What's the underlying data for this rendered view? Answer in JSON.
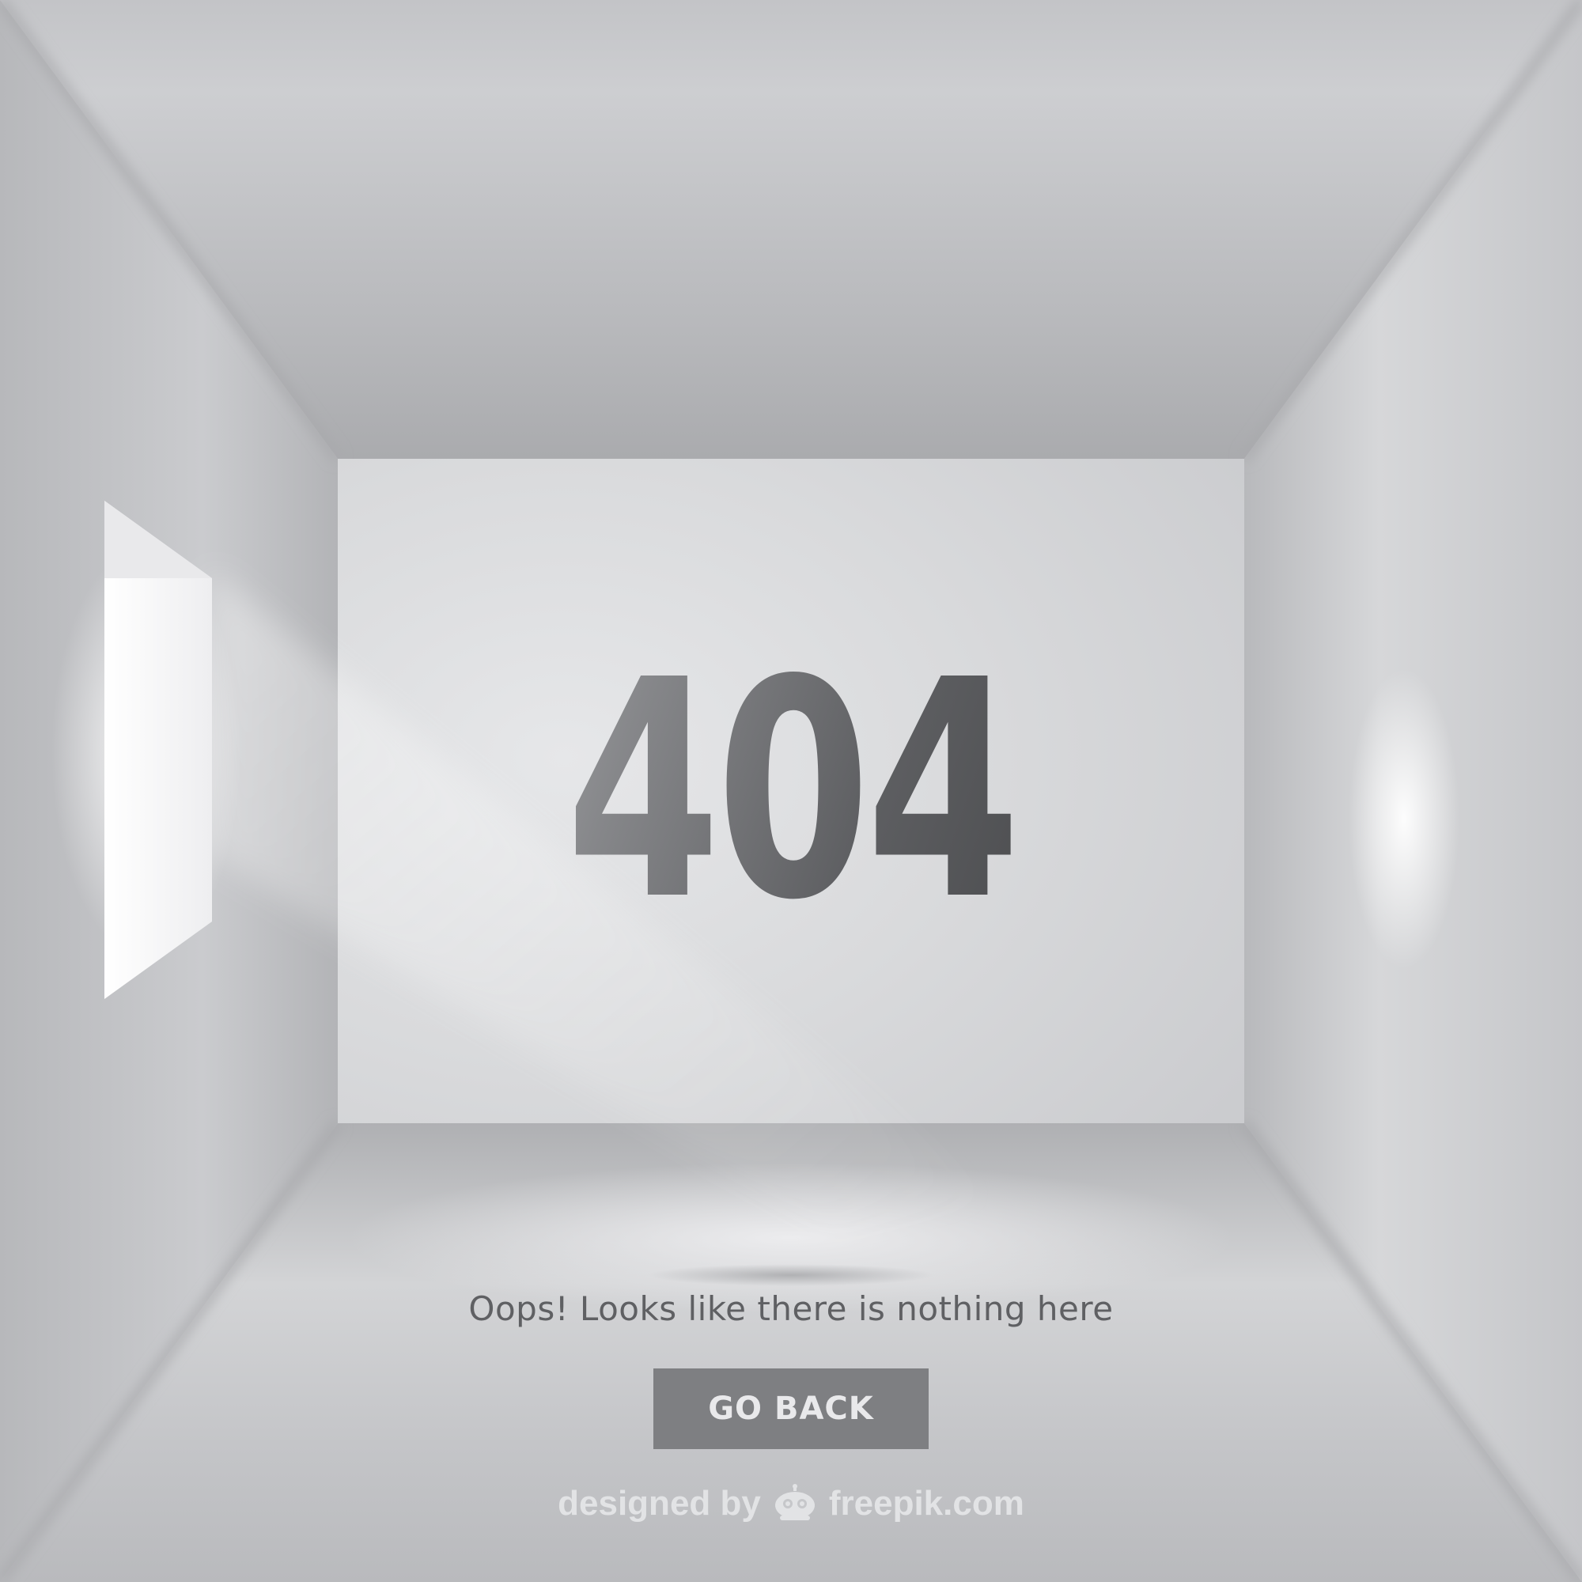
{
  "error": {
    "code": "404",
    "message": "Oops! Looks like there is nothing here"
  },
  "actions": {
    "go_back_label": "GO BACK"
  },
  "attribution": {
    "prefix": "designed by",
    "brand": "freepik.com"
  },
  "colors": {
    "button_bg": "#7e7f82",
    "button_text": "#e9e9eb",
    "message_text": "#5f6063",
    "room_light": "#e0e1e3",
    "room_shadow": "#aeafb2"
  },
  "icons": {
    "window": "window-light-icon",
    "brand": "freepik-logo-icon"
  }
}
